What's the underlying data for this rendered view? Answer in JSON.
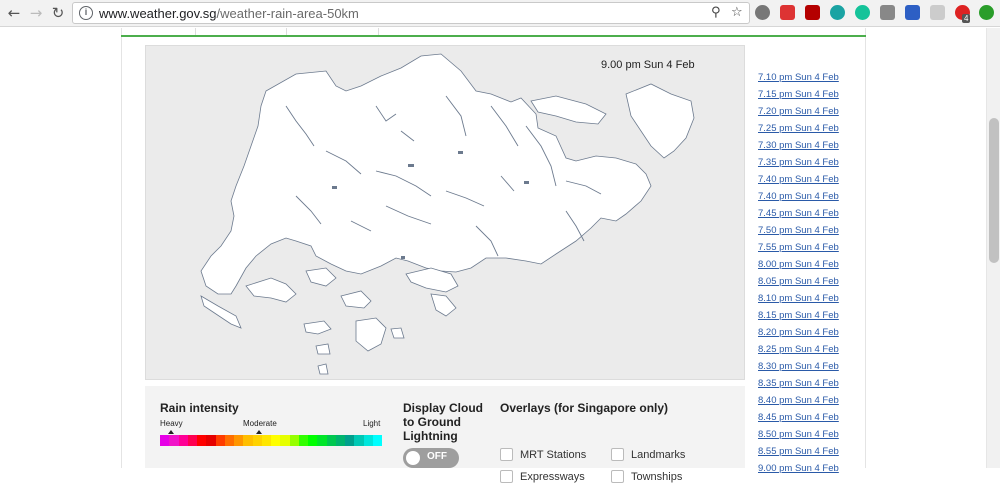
{
  "browser": {
    "url_domain": "www.weather.gov.sg",
    "url_path": "/weather-rain-area-50km",
    "back_icon": "back-arrow-icon",
    "forward_icon": "forward-arrow-icon",
    "reload_icon": "reload-icon",
    "zoom_icon": "zoom-icon",
    "star_icon": "star-icon",
    "extension_badge": "4",
    "extensions": [
      "lightbulb-extension-icon",
      "camera-extension-icon",
      "acrobat-extension-icon",
      "m-extension-icon",
      "grammarly-extension-icon",
      "pocket-extension-icon",
      "bookmark-extension-icon",
      "shield-extension-icon",
      "red-extension-icon",
      "green-extension-icon"
    ]
  },
  "map": {
    "timestamp": "9.00 pm Sun 4 Feb"
  },
  "legend": {
    "title": "Rain intensity",
    "heavy": "Heavy",
    "moderate": "Moderate",
    "light": "Light",
    "colors": [
      "#e600e6",
      "#f014c8",
      "#ff0096",
      "#ff0050",
      "#ff0000",
      "#e60000",
      "#ff3c00",
      "#ff6e00",
      "#ff9600",
      "#ffbe00",
      "#ffd200",
      "#ffe600",
      "#ffff00",
      "#e6ff00",
      "#96ff00",
      "#32ff00",
      "#00ff00",
      "#00e628",
      "#00c850",
      "#00b46e",
      "#00a08c",
      "#00c8b4",
      "#00e6dc",
      "#00ffff"
    ]
  },
  "lightning": {
    "title": "Display Cloud to Ground Lightning",
    "title_line1": "Display Cloud",
    "title_line2": "to Ground",
    "title_line3": "Lightning",
    "toggle_state": "OFF"
  },
  "overlays": {
    "title": "Overlays (for Singapore only)",
    "items": [
      {
        "label": "MRT Stations",
        "checked": false
      },
      {
        "label": "Landmarks",
        "checked": false
      },
      {
        "label": "Expressways",
        "checked": false
      },
      {
        "label": "Townships",
        "checked": false
      }
    ]
  },
  "times": [
    "7.10 pm Sun 4 Feb",
    "7.15 pm Sun 4 Feb",
    "7.20 pm Sun 4 Feb",
    "7.25 pm Sun 4 Feb",
    "7.30 pm Sun 4 Feb",
    "7.35 pm Sun 4 Feb",
    "7.40 pm Sun 4 Feb",
    "7.40 pm Sun 4 Feb",
    "7.45 pm Sun 4 Feb",
    "7.50 pm Sun 4 Feb",
    "7.55 pm Sun 4 Feb",
    "8.00 pm Sun 4 Feb",
    "8.05 pm Sun 4 Feb",
    "8.10 pm Sun 4 Feb",
    "8.15 pm Sun 4 Feb",
    "8.20 pm Sun 4 Feb",
    "8.25 pm Sun 4 Feb",
    "8.30 pm Sun 4 Feb",
    "8.35 pm Sun 4 Feb",
    "8.40 pm Sun 4 Feb",
    "8.45 pm Sun 4 Feb",
    "8.50 pm Sun 4 Feb",
    "8.55 pm Sun 4 Feb",
    "9.00 pm Sun 4 Feb"
  ]
}
